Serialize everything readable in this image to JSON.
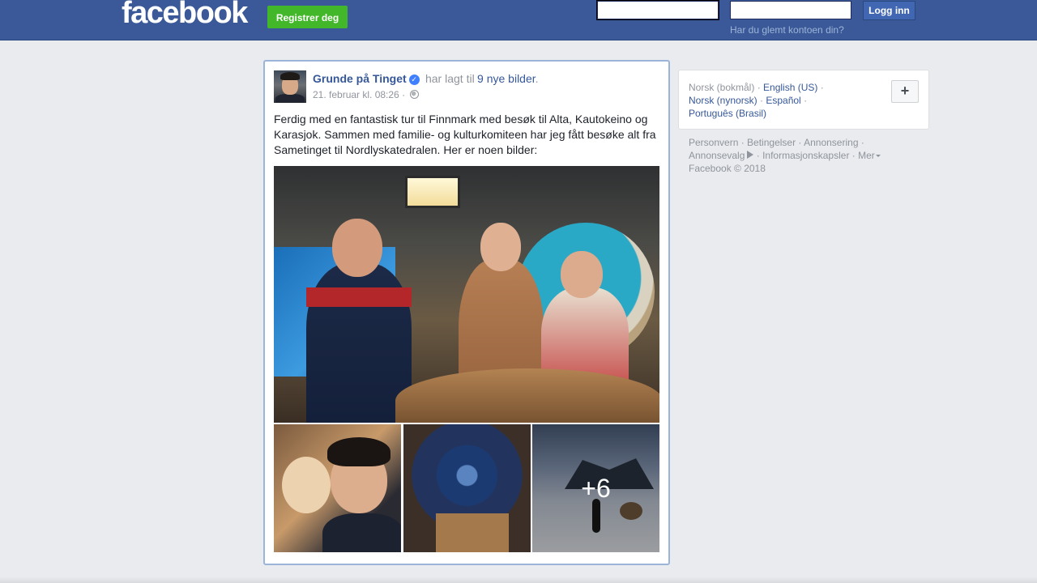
{
  "header": {
    "logo": "facebook",
    "register_label": "Registrer deg",
    "email_value": "",
    "password_value": "",
    "login_label": "Logg inn",
    "forgot_label": "Har du glemt kontoen din?",
    "brand_color": "#3b5998",
    "register_color": "#42b72a"
  },
  "post": {
    "author": "Grunde på Tinget",
    "verified_icon": "check",
    "action": "har lagt til",
    "photos_link": "9 nye bilder",
    "period": ".",
    "timestamp": "21. februar kl. 08:26",
    "meta_sep": "·",
    "privacy_icon": "globe-icon",
    "text": "Ferdig med en fantastisk tur til Finnmark med besøk til Alta, Kautokeino og Karasjok. Sammen med familie- og kulturkomiteen har jeg fått besøke alt fra Sametinget til Nordlyskatedralen. Her er noen bilder:",
    "more_photos": "+6"
  },
  "sidebar": {
    "languages": [
      {
        "label": "Norsk (bokmål)",
        "current": true
      },
      {
        "label": "English (US)",
        "current": false
      },
      {
        "label": "Norsk (nynorsk)",
        "current": false
      },
      {
        "label": "Español",
        "current": false
      },
      {
        "label": "Português (Brasil)",
        "current": false
      }
    ],
    "add_language_label": "+",
    "footer": {
      "privacy": "Personvern",
      "terms": "Betingelser",
      "advertising": "Annonsering",
      "adchoices": "Annonsevalg",
      "cookies": "Informasjonskapsler",
      "more": "Mer",
      "copyright": "Facebook © 2018"
    }
  }
}
